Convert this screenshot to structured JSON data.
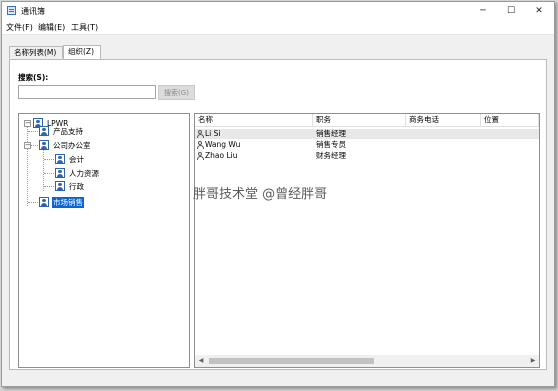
{
  "window": {
    "title": "通讯簿",
    "app_icon": "address-book-icon",
    "controls": {
      "minimize": "─",
      "maximize": "☐",
      "close": "✕"
    }
  },
  "menu": [
    {
      "label": "文件(F)"
    },
    {
      "label": "编辑(E)"
    },
    {
      "label": "工具(T)"
    }
  ],
  "tabs": [
    {
      "label": "名称列表(M)",
      "active": false
    },
    {
      "label": "组织(Z)",
      "active": true
    }
  ],
  "search": {
    "label": "搜索(S):",
    "value": "",
    "button_label": "搜索(G)"
  },
  "tree": {
    "nodes": [
      {
        "label": "LPWR",
        "icon": "org-node-icon",
        "expanded": true
      },
      {
        "label": "产品支持",
        "icon": "org-node-icon"
      },
      {
        "label": "公司办公室",
        "icon": "org-node-icon",
        "expanded": true
      },
      {
        "label": "会计",
        "icon": "org-node-icon"
      },
      {
        "label": "人力资源",
        "icon": "org-node-icon"
      },
      {
        "label": "行政",
        "icon": "org-node-icon"
      },
      {
        "label": "市场销售",
        "icon": "org-node-icon",
        "selected": true
      }
    ],
    "toggle_expanded": "−"
  },
  "list": {
    "columns": [
      "名称",
      "职务",
      "商务电话",
      "位置"
    ],
    "rows": [
      {
        "name": "Li Si",
        "title": "销售经理",
        "phone": "",
        "location": "",
        "selected": true
      },
      {
        "name": "Wang Wu",
        "title": "销售专员",
        "phone": "",
        "location": ""
      },
      {
        "name": "Zhao Liu",
        "title": "财务经理",
        "phone": "",
        "location": ""
      }
    ],
    "scroll_left": "◀",
    "scroll_right": "▶"
  },
  "watermark": "胖哥技术堂 @曾经胖哥",
  "colors": {
    "selection": "#0a64d6",
    "icon_blue": "#2f63b0"
  }
}
